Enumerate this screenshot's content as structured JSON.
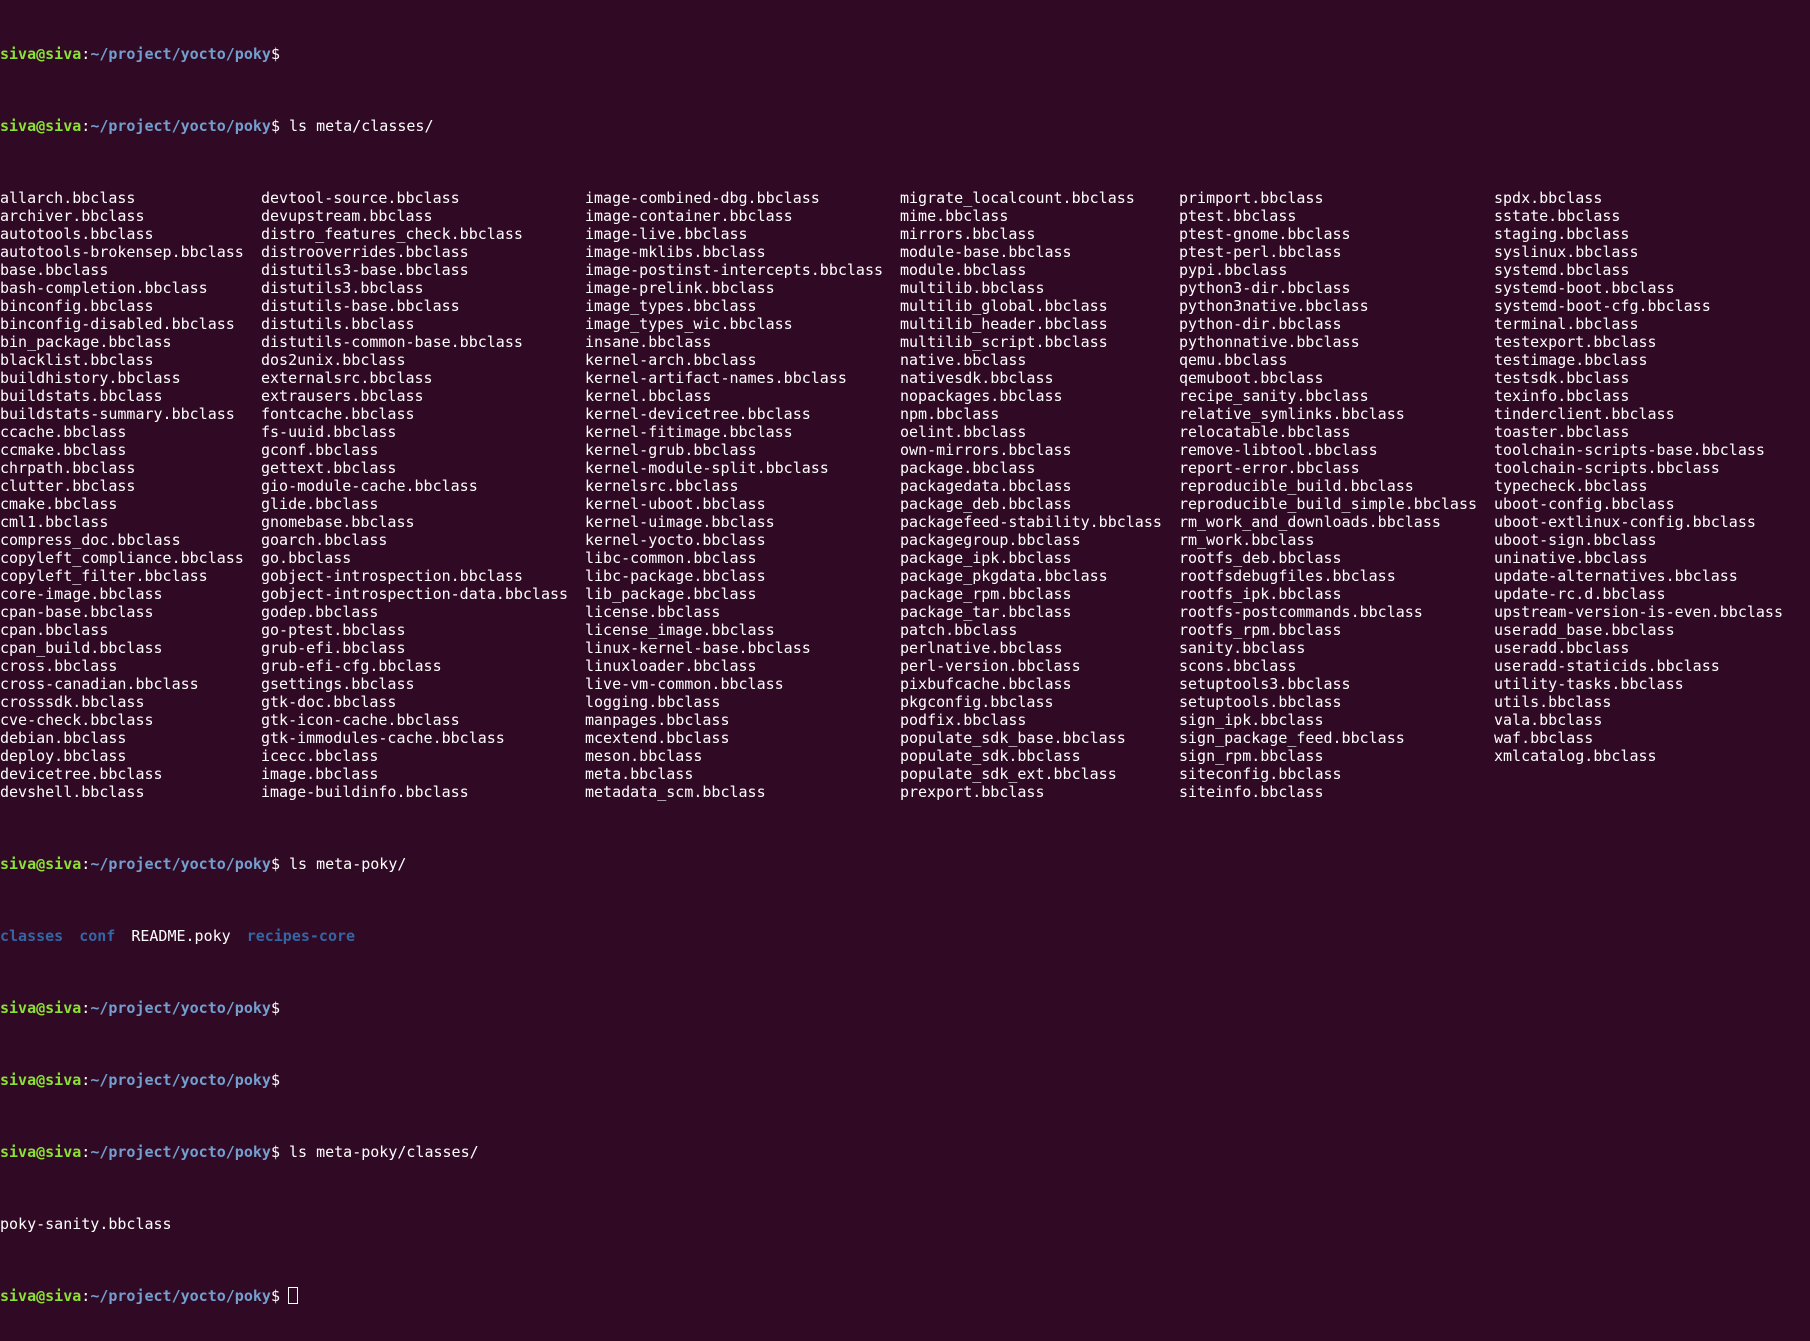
{
  "prompt": {
    "user": "siva@siva",
    "separator": ":",
    "path": "~/project/yocto/poky",
    "symbol": "$"
  },
  "commands": {
    "first": "",
    "ls_classes": "ls meta/classes/",
    "ls_meta_poky": "ls meta-poky/",
    "empty1": "",
    "empty2": "",
    "ls_meta_poky_classes": "ls meta-poky/classes/",
    "current": ""
  },
  "listing_columns": [
    [
      "allarch.bbclass",
      "archiver.bbclass",
      "autotools.bbclass",
      "autotools-brokensep.bbclass",
      "base.bbclass",
      "bash-completion.bbclass",
      "binconfig.bbclass",
      "binconfig-disabled.bbclass",
      "bin_package.bbclass",
      "blacklist.bbclass",
      "buildhistory.bbclass",
      "buildstats.bbclass",
      "buildstats-summary.bbclass",
      "ccache.bbclass",
      "ccmake.bbclass",
      "chrpath.bbclass",
      "clutter.bbclass",
      "cmake.bbclass",
      "cml1.bbclass",
      "compress_doc.bbclass",
      "copyleft_compliance.bbclass",
      "copyleft_filter.bbclass",
      "core-image.bbclass",
      "cpan-base.bbclass",
      "cpan.bbclass",
      "cpan_build.bbclass",
      "cross.bbclass",
      "cross-canadian.bbclass",
      "crosssdk.bbclass",
      "cve-check.bbclass",
      "debian.bbclass",
      "deploy.bbclass",
      "devicetree.bbclass",
      "devshell.bbclass"
    ],
    [
      "devtool-source.bbclass",
      "devupstream.bbclass",
      "distro_features_check.bbclass",
      "distrooverrides.bbclass",
      "distutils3-base.bbclass",
      "distutils3.bbclass",
      "distutils-base.bbclass",
      "distutils.bbclass",
      "distutils-common-base.bbclass",
      "dos2unix.bbclass",
      "externalsrc.bbclass",
      "extrausers.bbclass",
      "fontcache.bbclass",
      "fs-uuid.bbclass",
      "gconf.bbclass",
      "gettext.bbclass",
      "gio-module-cache.bbclass",
      "glide.bbclass",
      "gnomebase.bbclass",
      "goarch.bbclass",
      "go.bbclass",
      "gobject-introspection.bbclass",
      "gobject-introspection-data.bbclass",
      "godep.bbclass",
      "go-ptest.bbclass",
      "grub-efi.bbclass",
      "grub-efi-cfg.bbclass",
      "gsettings.bbclass",
      "gtk-doc.bbclass",
      "gtk-icon-cache.bbclass",
      "gtk-immodules-cache.bbclass",
      "icecc.bbclass",
      "image.bbclass",
      "image-buildinfo.bbclass"
    ],
    [
      "image-combined-dbg.bbclass",
      "image-container.bbclass",
      "image-live.bbclass",
      "image-mklibs.bbclass",
      "image-postinst-intercepts.bbclass",
      "image-prelink.bbclass",
      "image_types.bbclass",
      "image_types_wic.bbclass",
      "insane.bbclass",
      "kernel-arch.bbclass",
      "kernel-artifact-names.bbclass",
      "kernel.bbclass",
      "kernel-devicetree.bbclass",
      "kernel-fitimage.bbclass",
      "kernel-grub.bbclass",
      "kernel-module-split.bbclass",
      "kernelsrc.bbclass",
      "kernel-uboot.bbclass",
      "kernel-uimage.bbclass",
      "kernel-yocto.bbclass",
      "libc-common.bbclass",
      "libc-package.bbclass",
      "lib_package.bbclass",
      "license.bbclass",
      "license_image.bbclass",
      "linux-kernel-base.bbclass",
      "linuxloader.bbclass",
      "live-vm-common.bbclass",
      "logging.bbclass",
      "manpages.bbclass",
      "mcextend.bbclass",
      "meson.bbclass",
      "meta.bbclass",
      "metadata_scm.bbclass"
    ],
    [
      "migrate_localcount.bbclass",
      "mime.bbclass",
      "mirrors.bbclass",
      "module-base.bbclass",
      "module.bbclass",
      "multilib.bbclass",
      "multilib_global.bbclass",
      "multilib_header.bbclass",
      "multilib_script.bbclass",
      "native.bbclass",
      "nativesdk.bbclass",
      "nopackages.bbclass",
      "npm.bbclass",
      "oelint.bbclass",
      "own-mirrors.bbclass",
      "package.bbclass",
      "packagedata.bbclass",
      "package_deb.bbclass",
      "packagefeed-stability.bbclass",
      "packagegroup.bbclass",
      "package_ipk.bbclass",
      "package_pkgdata.bbclass",
      "package_rpm.bbclass",
      "package_tar.bbclass",
      "patch.bbclass",
      "perlnative.bbclass",
      "perl-version.bbclass",
      "pixbufcache.bbclass",
      "pkgconfig.bbclass",
      "podfix.bbclass",
      "populate_sdk_base.bbclass",
      "populate_sdk.bbclass",
      "populate_sdk_ext.bbclass",
      "prexport.bbclass"
    ],
    [
      "primport.bbclass",
      "ptest.bbclass",
      "ptest-gnome.bbclass",
      "ptest-perl.bbclass",
      "pypi.bbclass",
      "python3-dir.bbclass",
      "python3native.bbclass",
      "python-dir.bbclass",
      "pythonnative.bbclass",
      "qemu.bbclass",
      "qemuboot.bbclass",
      "recipe_sanity.bbclass",
      "relative_symlinks.bbclass",
      "relocatable.bbclass",
      "remove-libtool.bbclass",
      "report-error.bbclass",
      "reproducible_build.bbclass",
      "reproducible_build_simple.bbclass",
      "rm_work_and_downloads.bbclass",
      "rm_work.bbclass",
      "rootfs_deb.bbclass",
      "rootfsdebugfiles.bbclass",
      "rootfs_ipk.bbclass",
      "rootfs-postcommands.bbclass",
      "rootfs_rpm.bbclass",
      "sanity.bbclass",
      "scons.bbclass",
      "setuptools3.bbclass",
      "setuptools.bbclass",
      "sign_ipk.bbclass",
      "sign_package_feed.bbclass",
      "sign_rpm.bbclass",
      "siteconfig.bbclass",
      "siteinfo.bbclass"
    ],
    [
      "spdx.bbclass",
      "sstate.bbclass",
      "staging.bbclass",
      "syslinux.bbclass",
      "systemd.bbclass",
      "systemd-boot.bbclass",
      "systemd-boot-cfg.bbclass",
      "terminal.bbclass",
      "testexport.bbclass",
      "testimage.bbclass",
      "testsdk.bbclass",
      "texinfo.bbclass",
      "tinderclient.bbclass",
      "toaster.bbclass",
      "toolchain-scripts-base.bbclass",
      "toolchain-scripts.bbclass",
      "typecheck.bbclass",
      "uboot-config.bbclass",
      "uboot-extlinux-config.bbclass",
      "uboot-sign.bbclass",
      "uninative.bbclass",
      "update-alternatives.bbclass",
      "update-rc.d.bbclass",
      "upstream-version-is-even.bbclass",
      "useradd_base.bbclass",
      "useradd.bbclass",
      "useradd-staticids.bbclass",
      "utility-tasks.bbclass",
      "utils.bbclass",
      "vala.bbclass",
      "waf.bbclass",
      "xmlcatalog.bbclass"
    ]
  ],
  "meta_poky_listing": {
    "dir1": "classes",
    "dir2": "conf",
    "file1": "README.poky",
    "dir3": "recipes-core"
  },
  "meta_poky_classes_listing": "poky-sanity.bbclass"
}
